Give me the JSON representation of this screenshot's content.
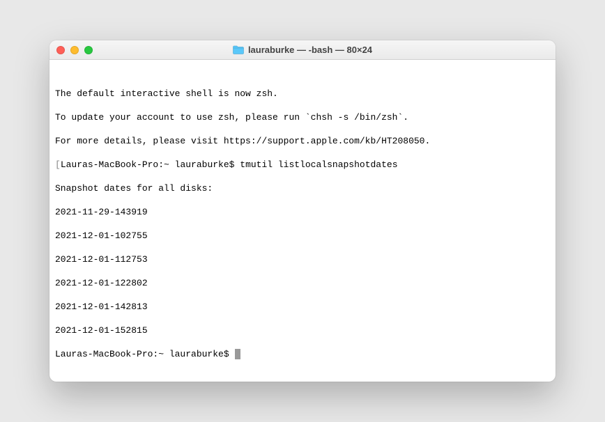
{
  "window": {
    "title": "lauraburke — -bash — 80×24"
  },
  "terminal": {
    "lines": [
      "",
      "The default interactive shell is now zsh.",
      "To update your account to use zsh, please run `chsh -s /bin/zsh`.",
      "For more details, please visit https://support.apple.com/kb/HT208050."
    ],
    "command_line": {
      "open_bracket": "[",
      "prompt": "Lauras-MacBook-Pro:~ lauraburke$ ",
      "command": "tmutil listlocalsnapshotdates",
      "close_bracket": "]"
    },
    "output_header": "Snapshot dates for all disks:",
    "snapshots": [
      "2021-11-29-143919",
      "2021-12-01-102755",
      "2021-12-01-112753",
      "2021-12-01-122802",
      "2021-12-01-142813",
      "2021-12-01-152815"
    ],
    "current_prompt": "Lauras-MacBook-Pro:~ lauraburke$ "
  }
}
